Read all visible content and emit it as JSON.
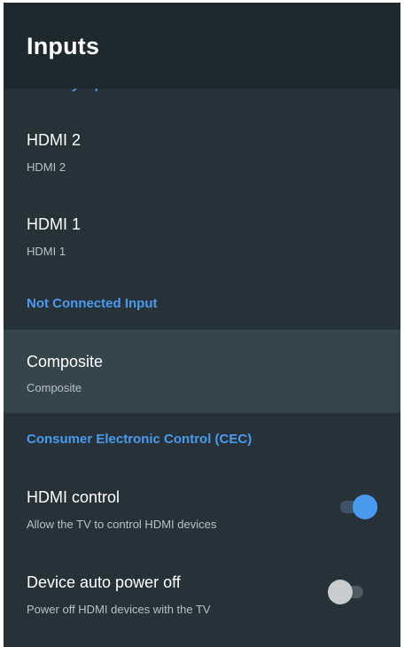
{
  "header": {
    "title": "Inputs"
  },
  "standby_section": {
    "label": "Standby inputs"
  },
  "standby_items": [
    {
      "title": "HDMI 2",
      "subtitle": "HDMI 2"
    },
    {
      "title": "HDMI 1",
      "subtitle": "HDMI 1"
    }
  ],
  "not_connected_section": {
    "label": "Not Connected Input"
  },
  "not_connected_items": [
    {
      "title": "Composite",
      "subtitle": "Composite"
    }
  ],
  "cec_section": {
    "label": "Consumer Electronic Control (CEC)"
  },
  "cec_items": [
    {
      "title": "HDMI control",
      "subtitle": "Allow the TV to control HDMI devices",
      "enabled": true
    },
    {
      "title": "Device auto power off",
      "subtitle": "Power off HDMI devices with the TV",
      "enabled": false
    }
  ],
  "colors": {
    "background": "#263238",
    "header": "#1e292e",
    "accent": "#4a9bf0",
    "focused_row": "#36444b"
  }
}
